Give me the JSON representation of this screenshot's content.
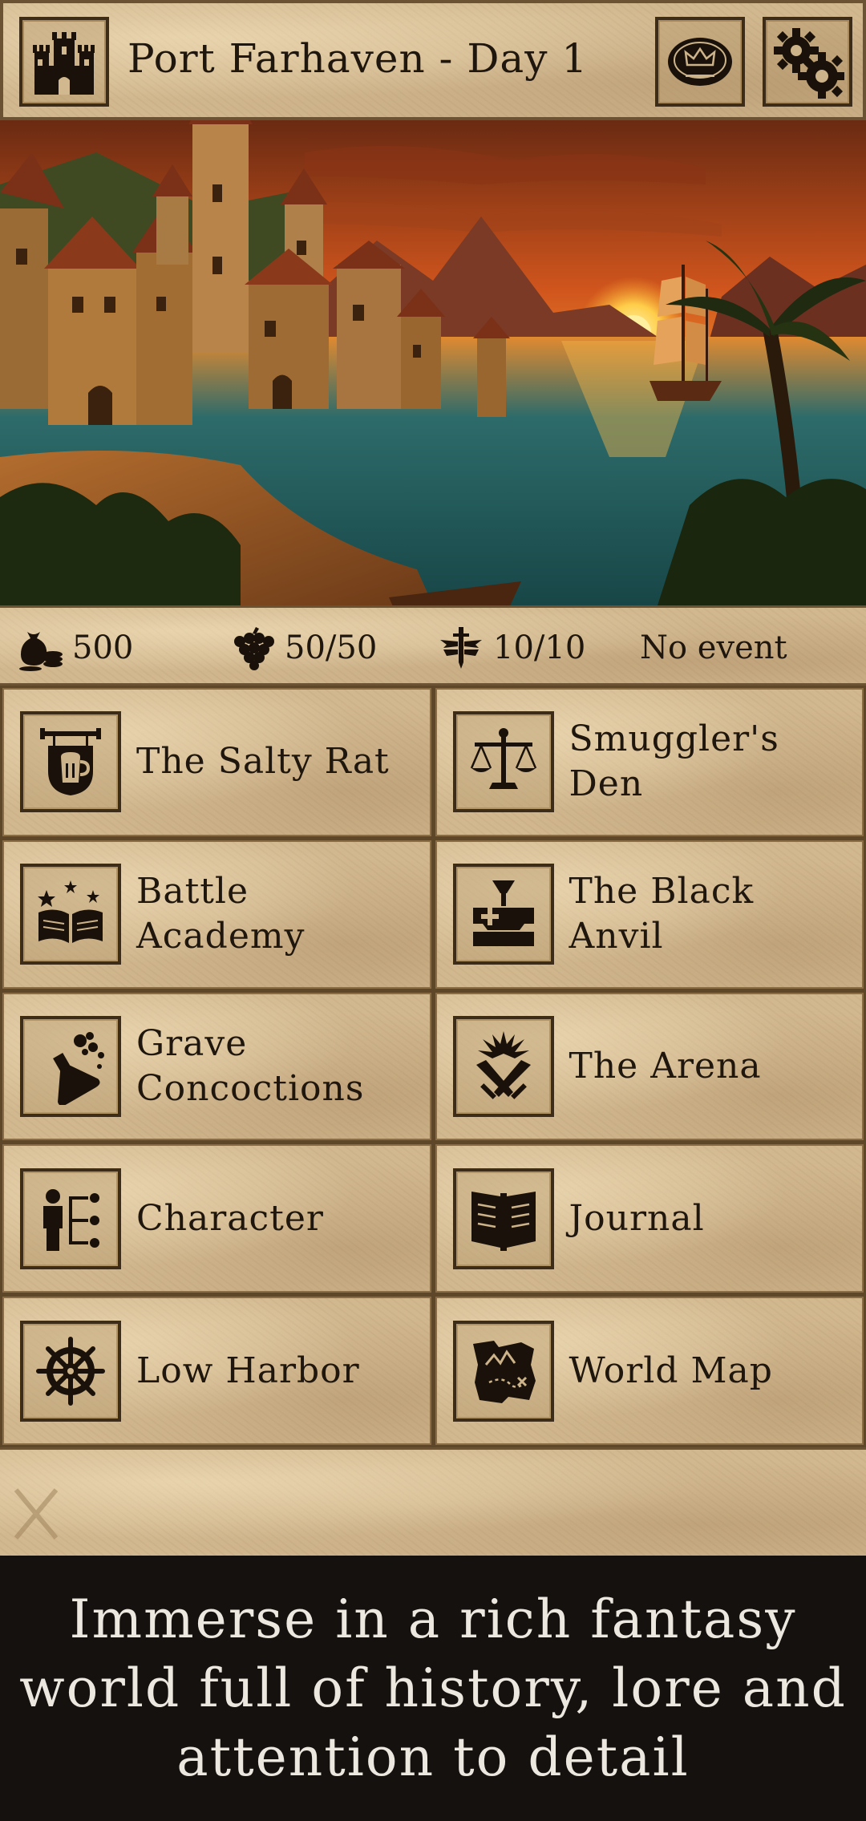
{
  "header": {
    "title": "Port Farhaven - Day 1",
    "castle_icon": "castle-icon",
    "crown_icon": "crown-icon",
    "settings_icon": "gears-icon"
  },
  "scene": {
    "description_icon": "harbor-town-sunset-illustration"
  },
  "stats": {
    "gold": {
      "icon": "coin-bag-icon",
      "value": "500"
    },
    "food": {
      "icon": "grapes-icon",
      "value": "50/50"
    },
    "hp": {
      "icon": "winged-sword-icon",
      "value": "10/10"
    },
    "event": {
      "value": "No event"
    }
  },
  "locations": [
    {
      "label": "The Salty Rat",
      "icon": "tavern-sign-icon"
    },
    {
      "label": "Smuggler's Den",
      "icon": "scales-icon"
    },
    {
      "label": "Battle Academy",
      "icon": "spellbook-icon"
    },
    {
      "label": "The Black Anvil",
      "icon": "anvil-icon"
    },
    {
      "label": "Grave Concoctions",
      "icon": "potion-flask-icon"
    },
    {
      "label": "The Arena",
      "icon": "crossed-swords-icon"
    },
    {
      "label": "Character",
      "icon": "character-tree-icon"
    },
    {
      "label": "Journal",
      "icon": "open-book-icon"
    },
    {
      "label": "Low Harbor",
      "icon": "ship-wheel-icon"
    },
    {
      "label": "World Map",
      "icon": "treasure-map-icon"
    }
  ],
  "caption": {
    "text": "Immerse in a rich fantasy world full of history, lore and attention to detail"
  },
  "colors": {
    "parchment": "#d2b88f",
    "ink": "#1f160d",
    "frame": "#5e4728",
    "caption_bg": "#15110e",
    "caption_text": "#ece7df"
  }
}
